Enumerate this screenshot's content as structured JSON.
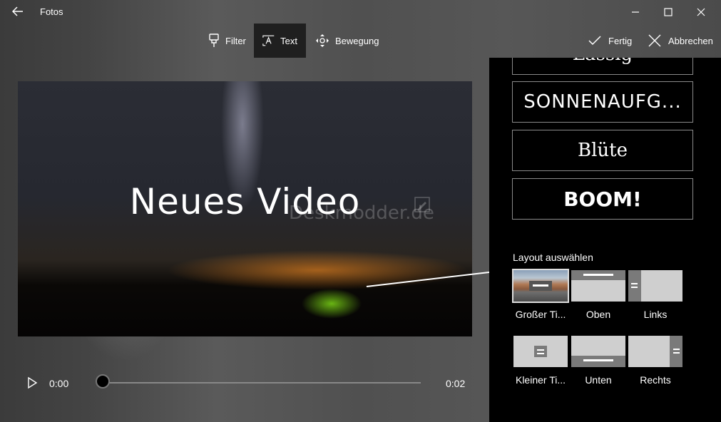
{
  "window": {
    "title": "Fotos",
    "back_icon": "back-arrow-icon",
    "minimize_icon": "minimize-icon",
    "maximize_icon": "maximize-icon",
    "close_icon": "close-icon"
  },
  "toolbar": {
    "filter_label": "Filter",
    "text_label": "Text",
    "motion_label": "Bewegung",
    "done_label": "Fertig",
    "cancel_label": "Abbrechen"
  },
  "video": {
    "title_text": "Neues Video",
    "watermark": "Deskmodder.de"
  },
  "player": {
    "current_time": "0:00",
    "end_time": "0:02",
    "progress": 0
  },
  "panel": {
    "styles": [
      {
        "label": "Lässig"
      },
      {
        "label": "SONNENAUFG..."
      },
      {
        "label": "Blüte"
      },
      {
        "label": "BOOM!"
      }
    ],
    "layout_heading": "Layout auswählen",
    "layouts": [
      {
        "label": "Großer Ti...",
        "selected": true
      },
      {
        "label": "Oben"
      },
      {
        "label": "Links"
      },
      {
        "label": "Kleiner Ti..."
      },
      {
        "label": "Unten"
      },
      {
        "label": "Rechts"
      }
    ]
  },
  "colors": {
    "panel_bg": "#000000",
    "active_tab_bg": "#1f1f1f",
    "tile_gray": "#cfcfcf",
    "tile_dark": "#7a7a7a"
  }
}
